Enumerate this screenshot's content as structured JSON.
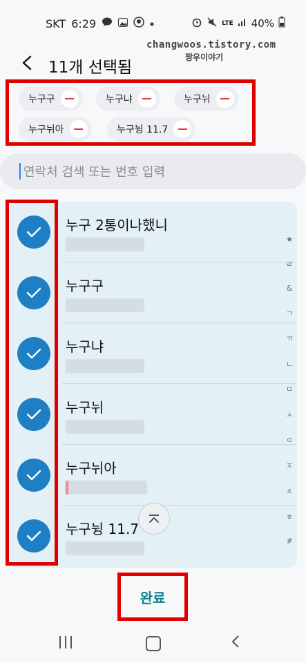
{
  "status_bar": {
    "carrier": "SKT",
    "time": "6:29",
    "network": "LTE",
    "battery": "40%"
  },
  "watermark": {
    "line1": "changwoos.tistory.com",
    "line2": "짱우이야기"
  },
  "header": {
    "title": "11개 선택됨"
  },
  "chips": [
    {
      "label": "누구구"
    },
    {
      "label": "누구냐"
    },
    {
      "label": "누구뉘"
    },
    {
      "label": "누구뉘아"
    },
    {
      "label": "누구뉭 11.7"
    }
  ],
  "search": {
    "placeholder": "연락처 검색 또는 번호 입력"
  },
  "contacts": [
    {
      "name": "누구 2통이나했니"
    },
    {
      "name": "누구구"
    },
    {
      "name": "누구냐"
    },
    {
      "name": "누구뉘"
    },
    {
      "name": "누구뉘아"
    },
    {
      "name": "누구뉭 11.7"
    }
  ],
  "index": [
    "★",
    "ㄹ",
    "&",
    "ㄱ",
    "ㄲ",
    "ㄴ",
    "ㅁ",
    "ㅅ",
    "ㅇ",
    "ㅈ",
    "ㅊ",
    "ㅎ",
    "#"
  ],
  "done_label": "완료",
  "colors": {
    "accent": "#1e7fc4",
    "done_text": "#0f7f90",
    "highlight": "#e00000",
    "remove": "#e03a3a"
  }
}
